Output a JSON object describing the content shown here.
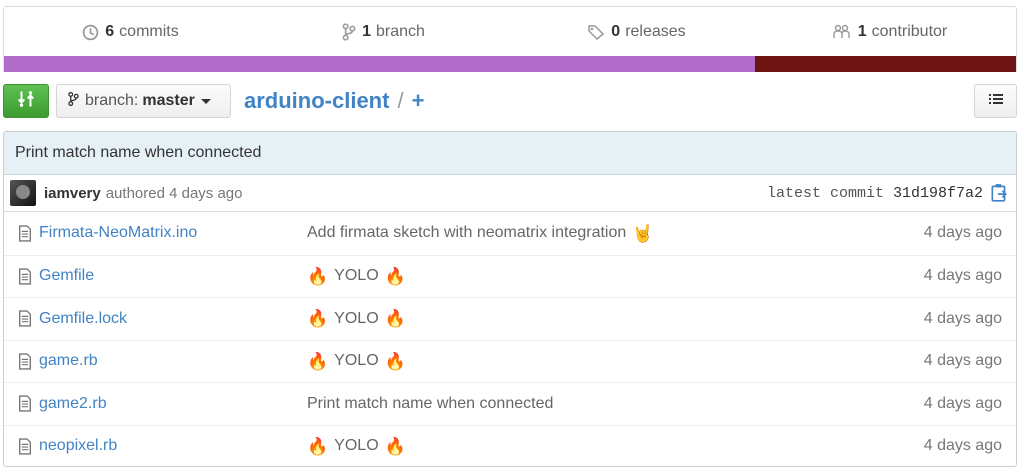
{
  "summary": {
    "commits": {
      "count": "6",
      "label": "commits",
      "icon": "history-icon"
    },
    "branches": {
      "count": "1",
      "label": "branch",
      "icon": "branch-icon"
    },
    "releases": {
      "count": "0",
      "label": "releases",
      "icon": "tag-icon"
    },
    "contributors": {
      "count": "1",
      "label": "contributor",
      "icon": "people-icon"
    }
  },
  "language_bar": [
    {
      "color": "#b26dcb",
      "fraction": 0.742
    },
    {
      "color": "#6e1412",
      "fraction": 0.258
    }
  ],
  "file_nav": {
    "branch_label": "branch:",
    "branch_value": "master",
    "repo": "arduino-client",
    "separator": "/",
    "plus": "+"
  },
  "latest_commit": {
    "message": "Print match name when connected",
    "author": "iamvery",
    "authored": "authored 4 days ago",
    "label": "latest commit",
    "sha": "31d198f7a2"
  },
  "files": [
    {
      "name": "Firmata-NeoMatrix.ino",
      "message": "Add firmata sketch with neomatrix integration",
      "emoji_right": "🤘",
      "age": "4 days ago"
    },
    {
      "name": "Gemfile",
      "emoji_left": "🔥",
      "message": "YOLO",
      "emoji_right": "🔥",
      "age": "4 days ago"
    },
    {
      "name": "Gemfile.lock",
      "emoji_left": "🔥",
      "message": "YOLO",
      "emoji_right": "🔥",
      "age": "4 days ago"
    },
    {
      "name": "game.rb",
      "emoji_left": "🔥",
      "message": "YOLO",
      "emoji_right": "🔥",
      "age": "4 days ago"
    },
    {
      "name": "game2.rb",
      "message": "Print match name when connected",
      "age": "4 days ago"
    },
    {
      "name": "neopixel.rb",
      "emoji_left": "🔥",
      "message": "YOLO",
      "emoji_right": "🔥",
      "age": "4 days ago"
    }
  ],
  "colors": {
    "link": "#4183c4",
    "compare_green": "#3d9b2f",
    "commit_bg": "#e6f1f6"
  }
}
